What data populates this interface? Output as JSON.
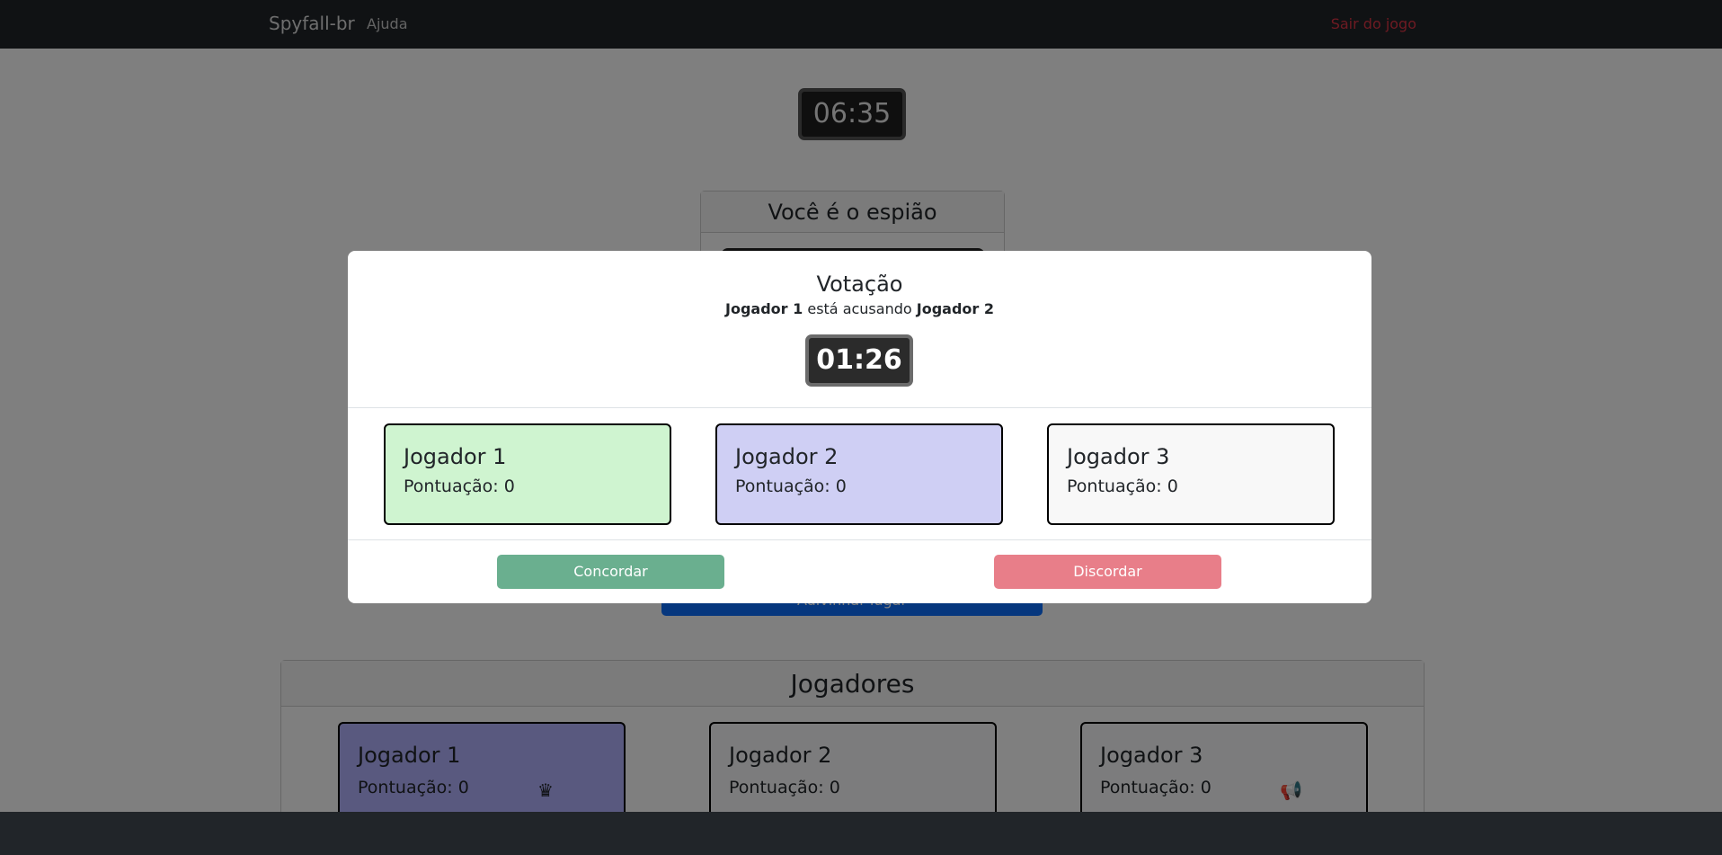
{
  "navbar": {
    "brand": "Spyfall-br",
    "help_link": "Ajuda",
    "exit_link": "Sair do jogo"
  },
  "game": {
    "timer": "06:35",
    "role_title": "Você é o espião",
    "guess_button": "Adivinhar lugar"
  },
  "players_panel": {
    "title": "Jogadores",
    "players": [
      {
        "name": "Jogador 1",
        "score": "Pontuação: 0",
        "icon": "crown-icon",
        "icon_glyph": "♛",
        "color": "#b3b3ff"
      },
      {
        "name": "Jogador 2",
        "score": "Pontuação: 0",
        "icon": "",
        "icon_glyph": "",
        "color": "#f8f9fa"
      },
      {
        "name": "Jogador 3",
        "score": "Pontuação: 0",
        "icon": "megaphone-icon",
        "icon_glyph": "📢",
        "color": "#f8f9fa"
      }
    ]
  },
  "vote_modal": {
    "title": "Votação",
    "accuser": "Jogador 1",
    "accusing_text": "está acusando",
    "accused": "Jogador 2",
    "timer": "01:26",
    "players": [
      {
        "name": "Jogador 1",
        "score": "Pontuação: 0",
        "color": "#cff4d0"
      },
      {
        "name": "Jogador 2",
        "score": "Pontuação: 0",
        "color": "#cfcff4"
      },
      {
        "name": "Jogador 3",
        "score": "Pontuação: 0",
        "color": "#f8f8f8"
      }
    ],
    "agree_button": "Concordar",
    "disagree_button": "Discordar",
    "agree_color": "#6aaf8f",
    "disagree_color": "#e87e89"
  }
}
